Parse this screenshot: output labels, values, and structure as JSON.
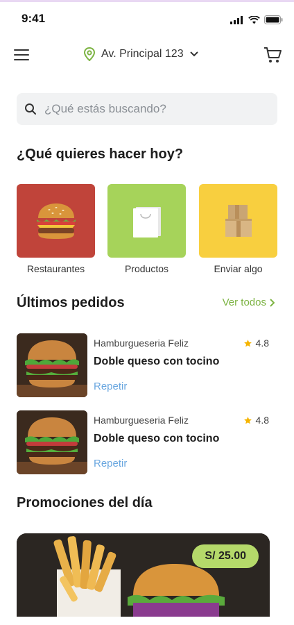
{
  "status_bar": {
    "time": "9:41"
  },
  "header": {
    "address": "Av. Principal 123"
  },
  "search": {
    "placeholder": "¿Qué estás buscando?"
  },
  "section_what": {
    "title": "¿Qué quieres hacer hoy?"
  },
  "categories": [
    {
      "label": "Restaurantes",
      "color": "#c0443a",
      "icon": "burger-icon"
    },
    {
      "label": "Productos",
      "color": "#a6d35a",
      "icon": "shopping-bag-icon"
    },
    {
      "label": "Enviar algo",
      "color": "#f8cf3f",
      "icon": "package-box-icon"
    }
  ],
  "recent_orders": {
    "title": "Últimos pedidos",
    "see_all": "Ver todos",
    "items": [
      {
        "restaurant": "Hamburgueseria Feliz",
        "rating": "4.8",
        "dish": "Doble queso con tocino",
        "action": "Repetir"
      },
      {
        "restaurant": "Hamburgueseria Feliz",
        "rating": "4.8",
        "dish": "Doble queso con tocino",
        "action": "Repetir"
      }
    ]
  },
  "promotions": {
    "title": "Promociones del día",
    "price": "S/ 25.00"
  },
  "colors": {
    "accent_green": "#7cb342",
    "link_blue": "#6aa7e0",
    "star": "#f5b400",
    "pill": "#b5d96a"
  }
}
